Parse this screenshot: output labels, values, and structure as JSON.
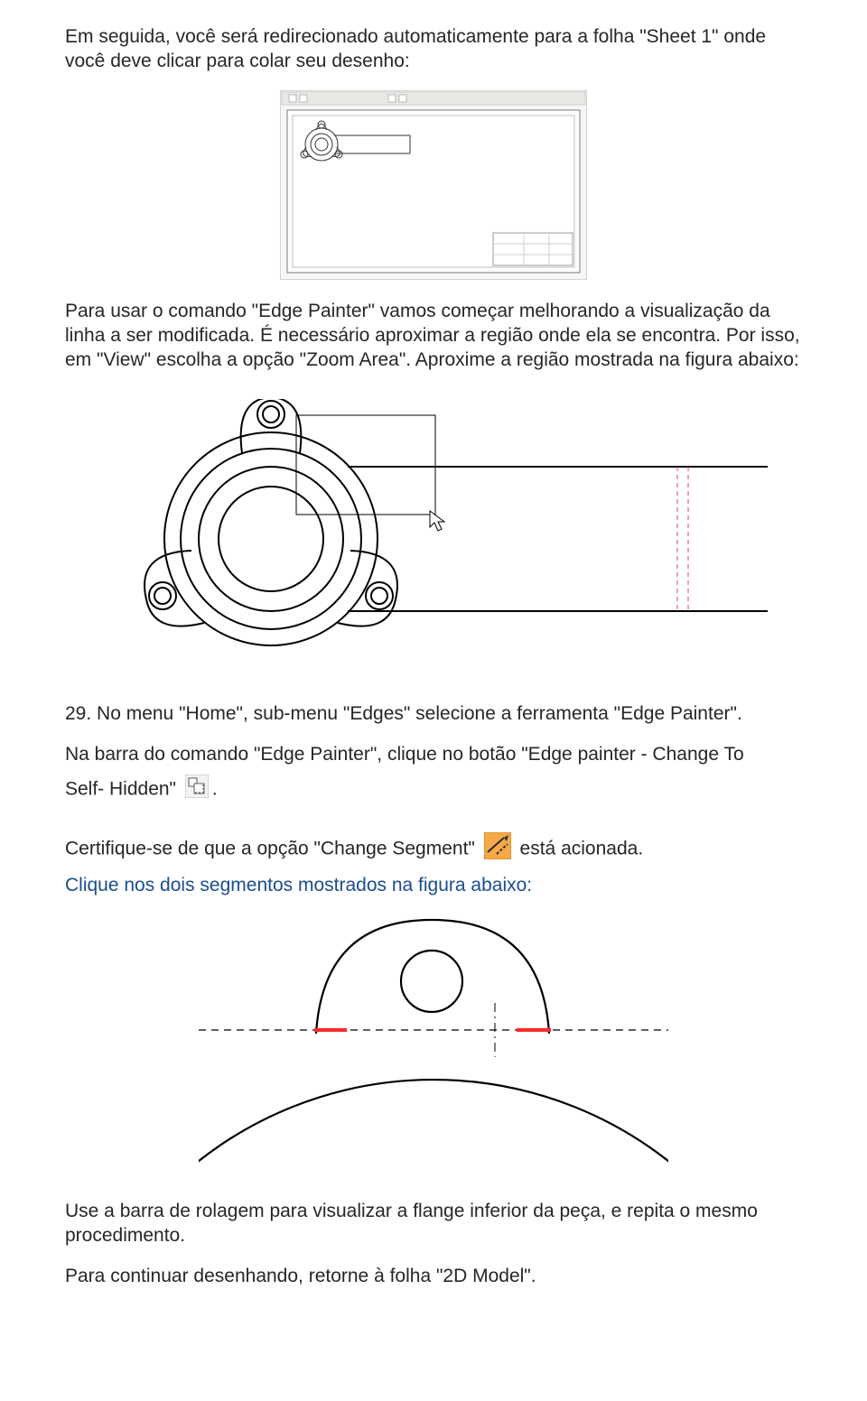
{
  "p1": "Em seguida, você será redirecionado automaticamente para a folha \"Sheet 1\" onde você deve clicar para colar seu desenho:",
  "p2": "Para usar o comando \"Edge Painter\" vamos começar melhorando a visualização da linha a ser modificada. É necessário aproximar a região onde ela se encontra. Por isso, em \"View\" escolha a opção \"Zoom Area\". Aproxime a região mostrada na figura abaixo:",
  "p3": "29. No menu \"Home\", sub-menu \"Edges\" selecione a ferramenta \"Edge Painter\".",
  "p4a": "Na barra do comando \"Edge Painter\", clique no botão \"Edge painter - Change To",
  "p4b": "Self- Hidden\" ",
  "p4b_tail": ".",
  "p5a": "Certifique-se de que a opção \"Change Segment\" ",
  "p5b": " está acionada.",
  "p6": "Clique nos dois segmentos mostrados na figura abaixo:",
  "p7": "Use a barra de rolagem para visualizar a flange inferior da peça, e repita o mesmo procedimento.",
  "p8": "Para continuar desenhando, retorne à folha \"2D Model\".",
  "icons": {
    "self_hidden": "self-hidden-icon",
    "change_segment": "change-segment-icon"
  }
}
